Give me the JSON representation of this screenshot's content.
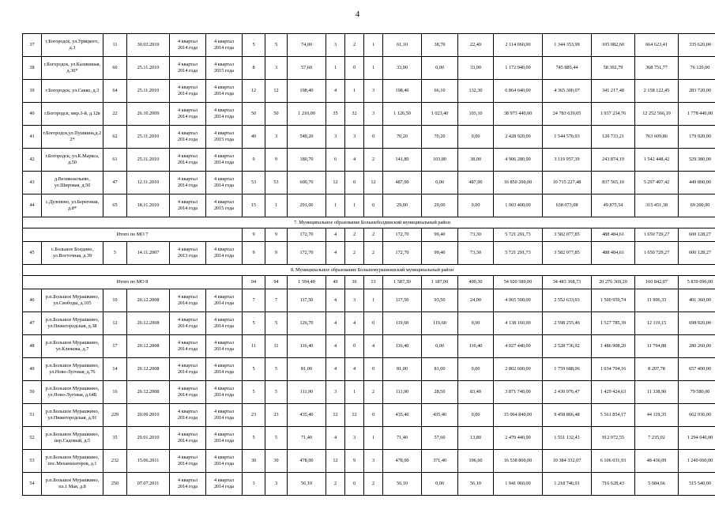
{
  "document": {
    "page_number": "4",
    "columns": 18
  },
  "sections": [
    {
      "type": "rows",
      "rows": [
        {
          "no": "37",
          "address": "г.Богородск, ул.Урицкого, д.3",
          "c2": "11",
          "date": "30.03.2010",
          "period_from_l1": "4 квартал",
          "period_from_l2": "2014 года",
          "period_to_l1": "4 квартал",
          "period_to_l2": "2014 года",
          "c5": "5",
          "c6": "5",
          "c7": "74,00",
          "c8": "3",
          "c9": "2",
          "c10": "1",
          "c11": "61,10",
          "c12": "38,70",
          "c13": "22,40",
          "m1": "2 114 060,00",
          "m2": "1 344 353,99",
          "m3": "105 082,60",
          "m4": "664 623,41",
          "m5": "335 620,00"
        },
        {
          "no": "38",
          "address": "г.Богородск, ул.Калининая, д.36*",
          "c2": "60",
          "date": "25.11.2010",
          "period_from_l1": "4 квартал",
          "period_from_l2": "2014 года",
          "period_to_l1": "4 квартал",
          "period_to_l2": "2015 года",
          "c5": "8",
          "c6": "3",
          "c7": "57,60",
          "c8": "1",
          "c9": "0",
          "c10": "1",
          "c11": "33,90",
          "c12": "0,00",
          "c13": "33,90",
          "m1": "1 172 940,00",
          "m2": "745 885,44",
          "m3": "58 302,79",
          "m4": "368 751,77",
          "m5": "76 120,00"
        },
        {
          "no": "39",
          "address": "г.Богородск, ул.Сакко, д.3",
          "c2": "64",
          "date": "25.11.2010",
          "period_from_l1": "4 квартал",
          "period_from_l2": "2014 года",
          "period_to_l1": "4 квартал",
          "period_to_l2": "2014 года",
          "c5": "12",
          "c6": "12",
          "c7": "198,40",
          "c8": "4",
          "c9": "1",
          "c10": "3",
          "c11": "198,40",
          "c12": "66,10",
          "c13": "132,30",
          "m1": "6 864 640,00",
          "m2": "4 365 300,07",
          "m3": "341 217,48",
          "m4": "2 158 122,45",
          "m5": "283 720,00"
        },
        {
          "no": "40",
          "address": "г.Богородск, мкр.3-й, д.12в",
          "c2": "22",
          "date": "26.10.2009",
          "period_from_l1": "4 квартал",
          "period_from_l2": "2014 года",
          "period_to_l1": "4 квартал",
          "period_to_l2": "2014 года",
          "c5": "50",
          "c6": "50",
          "c7": "1 210,00",
          "c8": "35",
          "c9": "32",
          "c10": "3",
          "c11": "1 126,50",
          "c12": "1 023,40",
          "c13": "103,10",
          "m1": "38 973 440,00",
          "m2": "24 783 639,05",
          "m3": "1 937 234,76",
          "m4": "12 252 566,19",
          "m5": "1 778 440,00"
        },
        {
          "no": "41",
          "address": "г.Богородск,ул.Пушкина,д.22*",
          "c2": "62",
          "date": "25.11.2010",
          "period_from_l1": "4 квартал",
          "period_from_l2": "2014 года",
          "period_to_l1": "4 квартал",
          "period_to_l2": "2015 года",
          "c5": "40",
          "c6": "3",
          "c7": "549,20",
          "c8": "3",
          "c9": "3",
          "c10": "0",
          "c11": "70,20",
          "c12": "70,20",
          "c13": "0,00",
          "m1": "2 428 920,00",
          "m2": "1 544 576,93",
          "m3": "120 733,21",
          "m4": "763 609,86",
          "m5": "179 920,00"
        },
        {
          "no": "42",
          "address": "г.Богородск, ул.К.Маркса, д.50",
          "c2": "61",
          "date": "25.11.2010",
          "period_from_l1": "4 квартал",
          "period_from_l2": "2014 года",
          "period_to_l1": "4 квартал",
          "period_to_l2": "2014 года",
          "c5": "9",
          "c6": "9",
          "c7": "180,70",
          "c8": "6",
          "c9": "4",
          "c10": "2",
          "c11": "141,80",
          "c12": "103,80",
          "c13": "38,00",
          "m1": "4 906 280,00",
          "m2": "3 119 957,39",
          "m3": "243 874,19",
          "m4": "1 542 448,42",
          "m5": "529 380,00"
        },
        {
          "no": "43",
          "address": "д.Великоseльево, ул.Шировая, д.50",
          "c2": "47",
          "date": "12.11.2010",
          "period_from_l1": "4 квартал",
          "period_from_l2": "2014 года",
          "period_to_l1": "4 квартал",
          "period_to_l2": "2014 года",
          "c5": "53",
          "c6": "53",
          "c7": "600,70",
          "c8": "12",
          "c9": "0",
          "c10": "12",
          "c11": "487,00",
          "c12": "0,00",
          "c13": "487,00",
          "m1": "16 850 200,00",
          "m2": "10 715 227,48",
          "m3": "837 565,10",
          "m4": "5 297 407,42",
          "m5": "449 800,00"
        },
        {
          "no": "44",
          "address": "с.Дуленево, ул.Береговая, д.8*",
          "c2": "65",
          "date": "18.11.2010",
          "period_from_l1": "4 квартал",
          "period_from_l2": "2014 года",
          "period_to_l1": "4 квартал",
          "period_to_l2": "2015 года",
          "c5": "15",
          "c6": "1",
          "c7": "291,00",
          "c8": "1",
          "c9": "1",
          "c10": "0",
          "c11": "29,00",
          "c12": "29,00",
          "c13": "0,00",
          "m1": "1 003 400,00",
          "m2": "638 073,08",
          "m3": "49 875,54",
          "m4": "315 451,38",
          "m5": "69 200,00"
        }
      ]
    }
  ],
  "section_header_7": "7. Муниципальное образование Большеболдинский муниципальный район",
  "section_header_8": "8. Муниципальное образование Большемурашкинский муниципальный район",
  "total_mo7": {
    "label": "Итого по МО 7",
    "c5": "9",
    "c6": "9",
    "c7": "172,70",
    "c8": "4",
    "c9": "2",
    "c10": "2",
    "c11": "172,70",
    "c12": "99,40",
    "c13": "73,30",
    "m1": "5 721 291,73",
    "m2": "3 582 077,85",
    "m3": "488 484,61",
    "m4": "1 650 729,27",
    "m5": "600 128,27"
  },
  "total_mo8": {
    "label": "Итого по МО 8",
    "c5": "94",
    "c6": "94",
    "c7": "1 594,40",
    "c8": "49",
    "c9": "36",
    "c10": "13",
    "c11": "1 587,30",
    "c12": "1 187,00",
    "c13": "400,30",
    "m1": "54 920 580,00",
    "m2": "34 483 368,73",
    "m3": "20 276 369,20",
    "m4": "160 842,07",
    "m5": "5 839 096,00"
  },
  "rows_mo7": [
    {
      "no": "45",
      "address": "с.Большое Болдино, ул.Восточная, д.39",
      "c2": "5",
      "date": "14.11.2007",
      "period_from_l1": "4 квартал",
      "period_from_l2": "2013 года",
      "period_to_l1": "4 квартал",
      "period_to_l2": "2014 года",
      "c5": "9",
      "c6": "9",
      "c7": "172,70",
      "c8": "4",
      "c9": "2",
      "c10": "2",
      "c11": "172,70",
      "c12": "99,40",
      "c13": "73,30",
      "m1": "5 721 291,73",
      "m2": "3 582 077,85",
      "m3": "488 484,61",
      "m4": "1 650 729,27",
      "m5": "600 128,27"
    }
  ],
  "rows_mo8": [
    {
      "no": "46",
      "address": "р.п.Большое Мурашкино, ул.Свободы, д.105",
      "c2": "10",
      "date": "20.12.2008",
      "period_from_l1": "4 квартал",
      "period_from_l2": "2014 года",
      "period_to_l1": "4 квартал",
      "period_to_l2": "2014 года",
      "c5": "7",
      "c6": "7",
      "c7": "117,50",
      "c8": "4",
      "c9": "3",
      "c10": "1",
      "c11": "117,50",
      "c12": "93,50",
      "c13": "24,00",
      "m1": "4 065 500,00",
      "m2": "2 552 633,93",
      "m3": "1 500 959,74",
      "m4": "11 906,33",
      "m5": "401 360,00"
    },
    {
      "no": "47",
      "address": "р.п.Большое Мурашкино, ул.Нижегородская, д.38",
      "c2": "12",
      "date": "20.12.2008",
      "period_from_l1": "4 квартал",
      "period_from_l2": "2014 года",
      "period_to_l1": "4 квартал",
      "period_to_l2": "2014 года",
      "c5": "5",
      "c6": "5",
      "c7": "126,70",
      "c8": "4",
      "c9": "4",
      "c10": "0",
      "c11": "119,60",
      "c12": "119,60",
      "c13": "0,00",
      "m1": "4 138 160,00",
      "m2": "2 598 255,46",
      "m3": "1 527 785,39",
      "m4": "12 119,15",
      "m5": "698 920,00"
    },
    {
      "no": "48",
      "address": "р.п.Большое Мурашкино, ул.Клюкова, д.7",
      "c2": "17",
      "date": "20.12.2008",
      "period_from_l1": "4 квартал",
      "period_from_l2": "2014 года",
      "period_to_l1": "4 квартал",
      "period_to_l2": "2014 года",
      "c5": "11",
      "c6": "11",
      "c7": "116,40",
      "c8": "4",
      "c9": "0",
      "c10": "4",
      "c11": "116,40",
      "c12": "0,00",
      "c13": "116,40",
      "m1": "4 027 440,00",
      "m2": "2 528 736,92",
      "m3": "1 486 908,20",
      "m4": "11 794,88",
      "m5": "280 260,00"
    },
    {
      "no": "49",
      "address": "р.п.Большое Мурашкино, ул.Ново-Луговая, д.76",
      "c2": "14",
      "date": "20.12.2008",
      "period_from_l1": "4 квартал",
      "period_from_l2": "2014 года",
      "period_to_l1": "4 квартал",
      "period_to_l2": "2014 года",
      "c5": "5",
      "c6": "5",
      "c7": "81,00",
      "c8": "4",
      "c9": "4",
      "c10": "0",
      "c11": "81,00",
      "c12": "81,00",
      "c13": "0,00",
      "m1": "2 802 600,00",
      "m2": "1 759 688,06",
      "m3": "1 034 704,16",
      "m4": "8 207,78",
      "m5": "657 400,00"
    },
    {
      "no": "50",
      "address": "р.п.Большое Мурашкино, ул.Ново-Луговая, д.64Б",
      "c2": "16",
      "date": "20.12.2008",
      "period_from_l1": "4 квартал",
      "period_from_l2": "2014 года",
      "period_to_l1": "4 квартал",
      "period_to_l2": "2014 года",
      "c5": "5",
      "c6": "5",
      "c7": "111,90",
      "c8": "3",
      "c9": "1",
      "c10": "2",
      "c11": "111,90",
      "c12": "28,50",
      "c13": "83,40",
      "m1": "3 871 740,00",
      "m2": "2 430 976,47",
      "m3": "1 429 424,63",
      "m4": "11 338,90",
      "m5": "79 580,00"
    },
    {
      "no": "51",
      "address": "р.п.Большое Мурашкино, ул.Нижегородская, д.91",
      "c2": "229",
      "date": "20.09.2010",
      "period_from_l1": "4 квартал",
      "period_from_l2": "2014 года",
      "period_to_l1": "4 квартал",
      "period_to_l2": "2014 года",
      "c5": "23",
      "c6": "23",
      "c7": "435,40",
      "c8": "12",
      "c9": "12",
      "c10": "0",
      "c11": "435,40",
      "c12": "435,40",
      "c13": "0,00",
      "m1": "15 064 840,00",
      "m2": "9 458 866,48",
      "m3": "5 561 854,17",
      "m4": "44 119,35",
      "m5": "662 936,00"
    },
    {
      "no": "52",
      "address": "р.п.Большое Мурашкино, пер.Садовый, д.5",
      "c2": "35",
      "date": "29.01.2010",
      "period_from_l1": "4 квартал",
      "period_from_l2": "2014 года",
      "period_to_l1": "4 квартал",
      "period_to_l2": "2014 года",
      "c5": "5",
      "c6": "5",
      "c7": "71,40",
      "c8": "4",
      "c9": "3",
      "c10": "1",
      "c11": "71,40",
      "c12": "57,60",
      "c13": "13,80",
      "m1": "2 470 440,00",
      "m2": "1 551 132,43",
      "m3": "912 072,55",
      "m4": "7 235,02",
      "m5": "1 294 040,00"
    },
    {
      "no": "53",
      "address": "р.п.Большое Мурашкино, пос.Механизаторов, д.1",
      "c2": "232",
      "date": "15.06.2011",
      "period_from_l1": "4 квартал",
      "period_from_l2": "2014 года",
      "period_to_l1": "4 квартал",
      "period_to_l2": "2014 года",
      "c5": "30",
      "c6": "30",
      "c7": "478,00",
      "c8": "12",
      "c9": "9",
      "c10": "3",
      "c11": "478,00",
      "c12": "371,40",
      "c13": "106,60",
      "m1": "16 538 800,00",
      "m2": "10 384 332,07",
      "m3": "6 106 031,93",
      "m4": "48 436,09",
      "m5": "1 249 060,00"
    },
    {
      "no": "54",
      "address": "р.п.Большое Мурашкино, пл.1 Мая, д.8",
      "c2": "250",
      "date": "07.07.2011",
      "period_from_l1": "4 квартал",
      "period_from_l2": "2014 года",
      "period_to_l1": "4 квартал",
      "period_to_l2": "2014 года",
      "c5": "3",
      "c6": "3",
      "c7": "56,10",
      "c8": "2",
      "c9": "0",
      "c10": "2",
      "c11": "56,10",
      "c12": "0,00",
      "c13": "56,10",
      "m1": "1 941 060,00",
      "m2": "1 218 746,91",
      "m3": "716 628,43",
      "m4": "5 684,66",
      "m5": "515 540,00"
    }
  ]
}
